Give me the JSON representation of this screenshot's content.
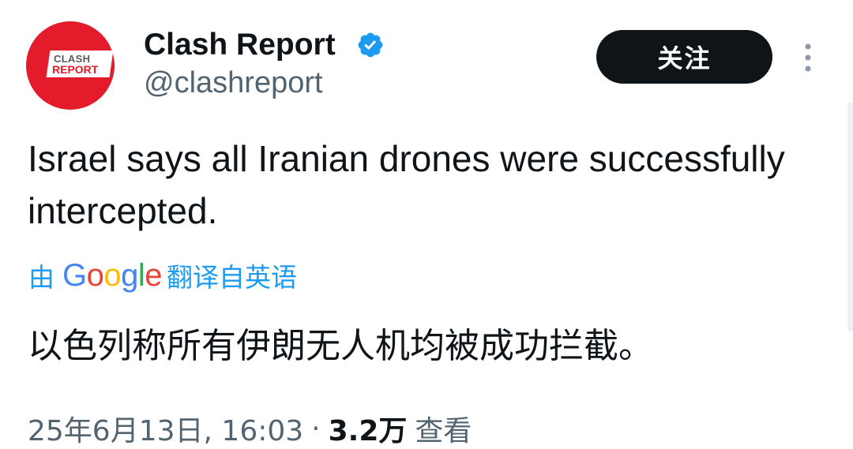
{
  "author": {
    "name": "Clash Report",
    "handle": "@clashreport",
    "avatar_text_top": "CLASH",
    "avatar_text_bottom": "REPORT",
    "verified": true
  },
  "follow_label": "关注",
  "tweet": {
    "text": "Israel says all Iranian drones were successfully intercepted."
  },
  "translation": {
    "prefix": "由",
    "brand": [
      "G",
      "o",
      "o",
      "g",
      "l",
      "e"
    ],
    "suffix": "翻译自英语",
    "text": "以色列称所有伊朗无人机均被成功拦截。"
  },
  "meta": {
    "timestamp": "25年6月13日, 16:03",
    "separator": "·",
    "views_count": "3.2万",
    "views_label": "查看"
  },
  "colors": {
    "brand_red": "#e31b2b",
    "verified_blue": "#1d9bf0",
    "link_blue": "#1d9bf0",
    "text": "#0f1419",
    "secondary": "#536471",
    "google": [
      "#4285F4",
      "#EA4335",
      "#FBBC05",
      "#4285F4",
      "#34A853",
      "#EA4335"
    ]
  },
  "icons": [
    "verified-badge-icon",
    "more-options-icon"
  ]
}
